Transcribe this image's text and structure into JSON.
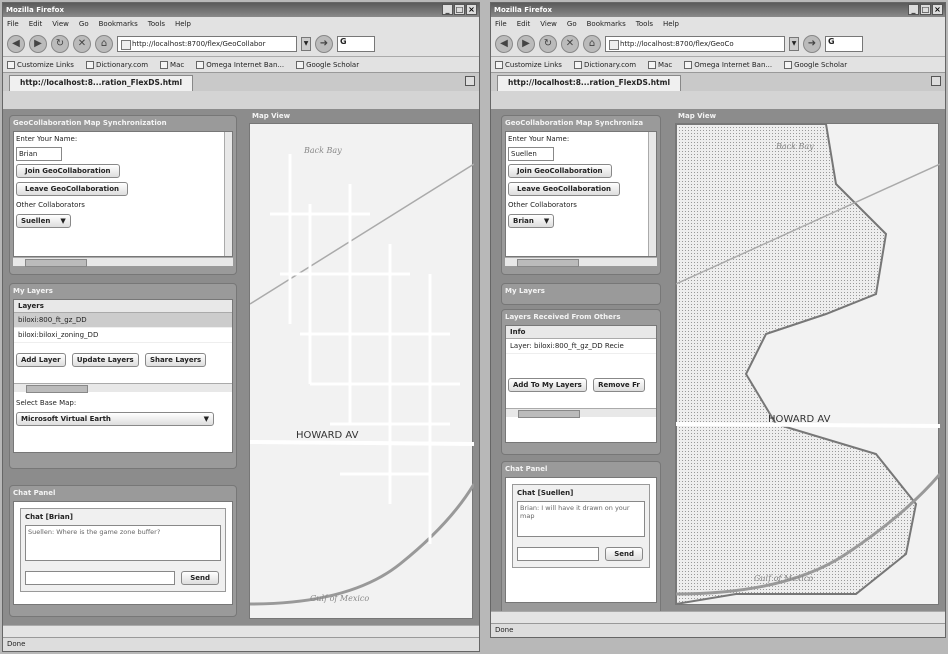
{
  "left": {
    "window_title": "Mozilla Firefox",
    "menu": [
      "File",
      "Edit",
      "View",
      "Go",
      "Bookmarks",
      "Tools",
      "Help"
    ],
    "url": "http://localhost:8700/flex/GeoCollabor",
    "search_value": "G",
    "bookmarks": [
      "Customize Links",
      "Dictionary.com",
      "Mac",
      "Omega Internet Ban...",
      "Google Scholar"
    ],
    "tab_title": "http://localhost:8...ration_FlexDS.html",
    "sync_panel": {
      "title": "GeoCollaboration Map Synchronization",
      "name_label": "Enter Your Name:",
      "name_value": "Brian",
      "join": "Join GeoCollaboration",
      "leave": "Leave GeoCollaboration",
      "others_label": "Other Collaborators",
      "other_selected": "Suellen"
    },
    "layers_panel": {
      "title": "My Layers",
      "header": "Layers",
      "rows": [
        "biloxi:800_ft_gz_DD",
        "biloxi:biloxi_zoning_DD"
      ],
      "add": "Add Layer",
      "update": "Update Layers",
      "share": "Share Layers",
      "basemap_label": "Select Base Map:",
      "basemap_value": "Microsoft Virtual Earth"
    },
    "chat_panel": {
      "title": "Chat Panel",
      "chat_title": "Chat [Brian]",
      "message": "Suellen: Where is the game zone buffer?",
      "send": "Send"
    },
    "map": {
      "title": "Map View",
      "label_top": "Back Bay",
      "street": "HOWARD AV",
      "label_bottom": "Gulf of Mexico"
    },
    "status": "Done"
  },
  "right": {
    "window_title": "Mozilla Firefox",
    "menu": [
      "File",
      "Edit",
      "View",
      "Go",
      "Bookmarks",
      "Tools",
      "Help"
    ],
    "url": "http://localhost:8700/flex/GeoCo",
    "search_value": "G",
    "bookmarks": [
      "Customize Links",
      "Dictionary.com",
      "Mac",
      "Omega Internet Ban...",
      "Google Scholar"
    ],
    "tab_title": "http://localhost:8...ration_FlexDS.html",
    "sync_panel": {
      "title": "GeoCollaboration Map Synchroniza",
      "name_label": "Enter Your Name:",
      "name_value": "Suellen",
      "join": "Join GeoCollaboration",
      "leave": "Leave GeoCollaboration",
      "others_label": "Other Collaborators",
      "other_selected": "Brian"
    },
    "layers_panel": {
      "title": "My Layers"
    },
    "received_panel": {
      "title": "Layers Received From Others",
      "header": "Info",
      "row": "Layer: biloxi:800_ft_gz_DD Recie",
      "add": "Add To My Layers",
      "remove": "Remove Fr"
    },
    "chat_panel": {
      "title": "Chat Panel",
      "chat_title": "Chat [Suellen]",
      "message": "Brian: I will have it drawn on your map",
      "send": "Send"
    },
    "map": {
      "title": "Map View",
      "label_top": "Back Bay",
      "street": "HOWARD AV",
      "label_bottom": "Gulf of Mexico"
    },
    "status": "Done"
  }
}
